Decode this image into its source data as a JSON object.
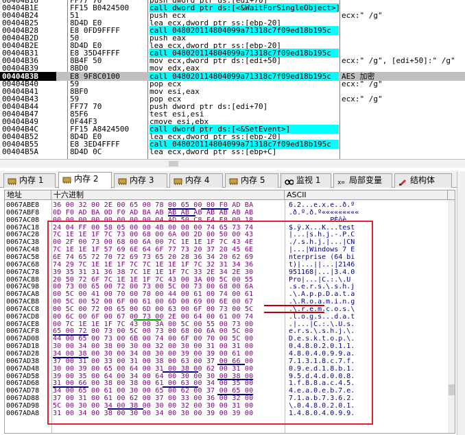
{
  "disasm": {
    "rows": [
      {
        "addr": "00404B16",
        "bytes": "FF77 70",
        "ins": "push dword ptr ds:[edi+70]",
        "call": false,
        "comment": ""
      },
      {
        "addr": "00404B1E",
        "bytes": "FF15 B0424500",
        "ins": "call dword ptr ds:[<&WaitForSingleObject>]",
        "call": true,
        "comment": ""
      },
      {
        "addr": "00404B24",
        "bytes": "51",
        "ins": "push ecx",
        "call": false,
        "comment": "ecx:\" /g\""
      },
      {
        "addr": "00404B25",
        "bytes": "8D4D E0",
        "ins": "lea ecx,dword ptr ss:[ebp-20]",
        "call": false,
        "comment": ""
      },
      {
        "addr": "00404B28",
        "bytes": "E8 0FD9FFFF",
        "ins": "call 048020114804099a71318c7f09ed18b195c",
        "call": true,
        "comment": ""
      },
      {
        "addr": "00404B2D",
        "bytes": "50",
        "ins": "push eax",
        "call": false,
        "comment": ""
      },
      {
        "addr": "00404B2E",
        "bytes": "8D4D E0",
        "ins": "lea ecx,dword ptr ss:[ebp-20]",
        "call": false,
        "comment": ""
      },
      {
        "addr": "00404B31",
        "bytes": "E8 35D4FFFF",
        "ins": "call 048020114804099a71318c7f09ed18b195c",
        "call": true,
        "comment": ""
      },
      {
        "addr": "00404B36",
        "bytes": "8B4F 50",
        "ins": "mov ecx,dword ptr ds:[edi+50]",
        "call": false,
        "comment": "ecx:\" /g\", [edi+50]:\" /g\""
      },
      {
        "addr": "00404B39",
        "bytes": "8BD0",
        "ins": "mov edx,eax",
        "call": false,
        "comment": ""
      },
      {
        "addr": "00404B3B",
        "bytes": "E8 9F8C0100",
        "ins": "call 048020114804099a71318c7f09ed18b195c",
        "call": true,
        "comment": "AES 加密",
        "selected": true
      },
      {
        "addr": "00404B40",
        "bytes": "59",
        "ins": "pop ecx",
        "call": false,
        "comment": "ecx:\" /g\""
      },
      {
        "addr": "00404B41",
        "bytes": "8BF0",
        "ins": "mov esi,eax",
        "call": false,
        "comment": ""
      },
      {
        "addr": "00404B43",
        "bytes": "59",
        "ins": "pop ecx",
        "call": false,
        "comment": "ecx:\" /g\""
      },
      {
        "addr": "00404B44",
        "bytes": "FF77 70",
        "ins": "push dword ptr ds:[edi+70]",
        "call": false,
        "comment": ""
      },
      {
        "addr": "00404B47",
        "bytes": "85F6",
        "ins": "test esi,esi",
        "call": false,
        "comment": ""
      },
      {
        "addr": "00404B49",
        "bytes": "0F44F3",
        "ins": "cmove esi,ebx",
        "call": false,
        "comment": ""
      },
      {
        "addr": "00404B4C",
        "bytes": "FF15 A8424500",
        "ins": "call dword ptr ds:[<&SetEvent>]",
        "call": true,
        "comment": ""
      },
      {
        "addr": "00404B52",
        "bytes": "8D4D E0",
        "ins": "lea ecx,dword ptr ss:[ebp-20]",
        "call": false,
        "comment": ""
      },
      {
        "addr": "00404B55",
        "bytes": "E8 3ED4FFFF",
        "ins": "call 048020114804099a71318c7f09ed18b195c",
        "call": true,
        "comment": ""
      },
      {
        "addr": "00404B5A",
        "bytes": "8D4D 0C",
        "ins": "lea ecx,dword ptr ss:[ebp+C]",
        "call": false,
        "comment": ""
      }
    ]
  },
  "tabs": [
    {
      "label": "内存 1",
      "icon": "memory-icon",
      "active": false
    },
    {
      "label": "内存 2",
      "icon": "memory-icon",
      "active": true
    },
    {
      "label": "内存 3",
      "icon": "memory-icon",
      "active": false
    },
    {
      "label": "内存 4",
      "icon": "memory-icon",
      "active": false
    },
    {
      "label": "内存 5",
      "icon": "memory-icon",
      "active": false
    },
    {
      "label": "监视 1",
      "icon": "watch-icon",
      "active": false
    },
    {
      "label": "局部变量",
      "icon": "locals-icon",
      "active": false
    },
    {
      "label": "结构体",
      "icon": "struct-icon",
      "active": false
    }
  ],
  "dump": {
    "headers": {
      "addr": "地址",
      "hex": "十六进制",
      "ascii": "ASCII"
    },
    "rows": [
      {
        "addr": "0067ABE8",
        "hex": "36 00 32 00 2E 00 65 00 78 00 65 00 00 F0 AD BA",
        "ascii": "6.2...e.x.e..ð.º"
      },
      {
        "addr": "0067ABF8",
        "hex": "0D F0 AD BA 0D F0 AD BA AB AB AB AB AB AB AB AB",
        "ascii": ".ð.º.ð.º«««««««««"
      },
      {
        "addr": "0067AC08",
        "hex": "00 00 00 00 00 00 00 00 04 AD 50 C8 F4 E8 00 18",
        "ascii": "..........PÈôè.."
      },
      {
        "addr": "0067AC18",
        "hex": "24 04 FF 00 58 05 00 00 4B 00 00 00 74 65 73 74",
        "ascii": "$.ÿ.X...K...test"
      },
      {
        "addr": "0067AC28",
        "hex": "7C 1E 1E 1F 7C 73 00 68 00 6A 00 2D 00 50 00 43",
        "ascii": "|...|s.h.j.-.P.C"
      },
      {
        "addr": "0067AC38",
        "hex": "00 2F 00 73 00 68 00 6A 00 7C 1E 1E 1F 7C 43 4E",
        "ascii": "./.s.h.j.|...|CN"
      },
      {
        "addr": "0067AC48",
        "hex": "7C 1E 1E 1F 57 69 6E 64 6F 77 73 20 37 20 45 6E",
        "ascii": "|...|Windows 7 E"
      },
      {
        "addr": "0067AC58",
        "hex": "6E 74 65 72 70 72 69 73 65 20 28 36 34 20 62 69",
        "ascii": "nterprise (64 bi"
      },
      {
        "addr": "0067AC68",
        "hex": "74 29 7C 1E 1E 1F 7C 7C 1E 1E 1F 7C 32 31 34 36",
        "ascii": "t)|...||...|2146"
      },
      {
        "addr": "0067AC78",
        "hex": "39 35 31 31 36 38 7C 1E 1E 1F 7C 33 2E 34 2E 30",
        "ascii": "951168|...|3.4.0"
      },
      {
        "addr": "0067AC88",
        "hex": "20 50 72 6F 7C 1E 1E 1F 7C 43 00 3A 00 5C 00 55",
        "ascii": " Pro|...|C.:.\\.U"
      },
      {
        "addr": "0067AC98",
        "hex": "00 73 00 65 00 72 00 73 00 5C 00 73 00 68 00 6A",
        "ascii": ".s.e.r.s.\\.s.h.j"
      },
      {
        "addr": "0067ACA8",
        "hex": "00 5C 00 41 00 70 00 70 00 44 00 61 00 74 00 61",
        "ascii": ".\\.A.p.p.D.a.t.a"
      },
      {
        "addr": "0067ACB8",
        "hex": "00 5C 00 52 00 6F 00 61 00 6D 00 69 00 6E 00 67",
        "ascii": ".\\.R.o.a.m.i.n.g"
      },
      {
        "addr": "0067ACC8",
        "hex": "00 5C 00 72 00 65 00 6D 00 63 00 6F 00 73 00 5C",
        "ascii": ".\\.r.e.m.c.o.s.\\"
      },
      {
        "addr": "0067ACD8",
        "hex": "00 6C 00 6F 00 67 00 73 00 2E 00 64 00 61 00 74",
        "ascii": ".l.o.g.s...d.a.t"
      },
      {
        "addr": "0067ACE8",
        "hex": "00 7C 1E 1E 1F 7C 43 00 3A 00 5C 00 55 00 73 00",
        "ascii": ".|...|C.:.\\.U.s."
      },
      {
        "addr": "0067ACF8",
        "hex": "65 00 72 00 73 00 5C 00 73 00 68 00 6A 00 5C 00",
        "ascii": "e.r.s.\\.s.h.j.\\."
      },
      {
        "addr": "0067AD08",
        "hex": "44 00 65 00 73 00 6B 00 74 00 6F 00 70 00 5C 00",
        "ascii": "D.e.s.k.t.o.p.\\."
      },
      {
        "addr": "0067AD18",
        "hex": "30 00 34 00 38 00 30 00 32 00 30 00 31 00 31 00",
        "ascii": "0.4.8.0.2.0.1.1."
      },
      {
        "addr": "0067AD28",
        "hex": "34 00 38 00 30 00 34 00 30 00 39 00 39 00 61 00",
        "ascii": "4.8.0.4.0.9.9.a."
      },
      {
        "addr": "0067AD38",
        "hex": "37 00 31 00 33 00 31 00 38 00 63 00 37 00 66 00",
        "ascii": "7.1.3.1.8.c.7.f."
      },
      {
        "addr": "0067AD48",
        "hex": "30 00 39 00 65 00 64 00 31 00 38 00 62 00 31 00",
        "ascii": "0.9.e.d.1.8.b.1."
      },
      {
        "addr": "0067AD58",
        "hex": "39 00 35 00 64 00 34 00 64 00 30 00 30 00 38 00",
        "ascii": "9.5.d.4.d.0.0.8."
      },
      {
        "addr": "0067AD68",
        "hex": "31 00 66 00 38 00 38 00 61 00 63 00 34 00 35 00",
        "ascii": "1.f.8.8.a.c.4.5."
      },
      {
        "addr": "0067AD78",
        "hex": "34 00 65 00 61 00 30 00 65 00 62 00 37 00 65 00",
        "ascii": "4.e.a.0.e.b.7.e."
      },
      {
        "addr": "0067AD88",
        "hex": "37 00 31 00 61 00 62 00 37 00 33 00 36 00 32 00",
        "ascii": "7.1.a.b.7.3.6.2."
      },
      {
        "addr": "0067AD98",
        "hex": "5C 00 30 00 34 00 38 00 30 00 32 00 30 00 31 00",
        "ascii": "\\.0.4.8.0.2.0.1."
      },
      {
        "addr": "0067ADA8",
        "hex": "31 00 34 00 38 00 30 00 34 00 30 00 39 00 39 00",
        "ascii": "1.4.8.0.4.0.9.9."
      }
    ]
  }
}
